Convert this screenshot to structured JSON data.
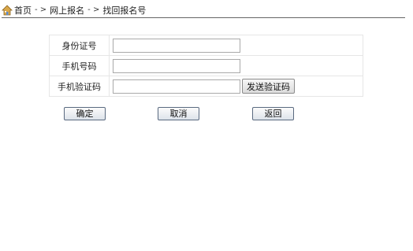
{
  "breadcrumb": {
    "home": "首页",
    "separator": "- >",
    "level1": "网上报名",
    "level2": "找回报名号"
  },
  "form": {
    "id_label": "身份证号",
    "id_value": "",
    "phone_label": "手机号码",
    "phone_value": "",
    "code_label": "手机验证码",
    "code_value": "",
    "send_code_button": "发送验证码"
  },
  "actions": {
    "confirm": "确定",
    "cancel": "取消",
    "back": "返回"
  }
}
